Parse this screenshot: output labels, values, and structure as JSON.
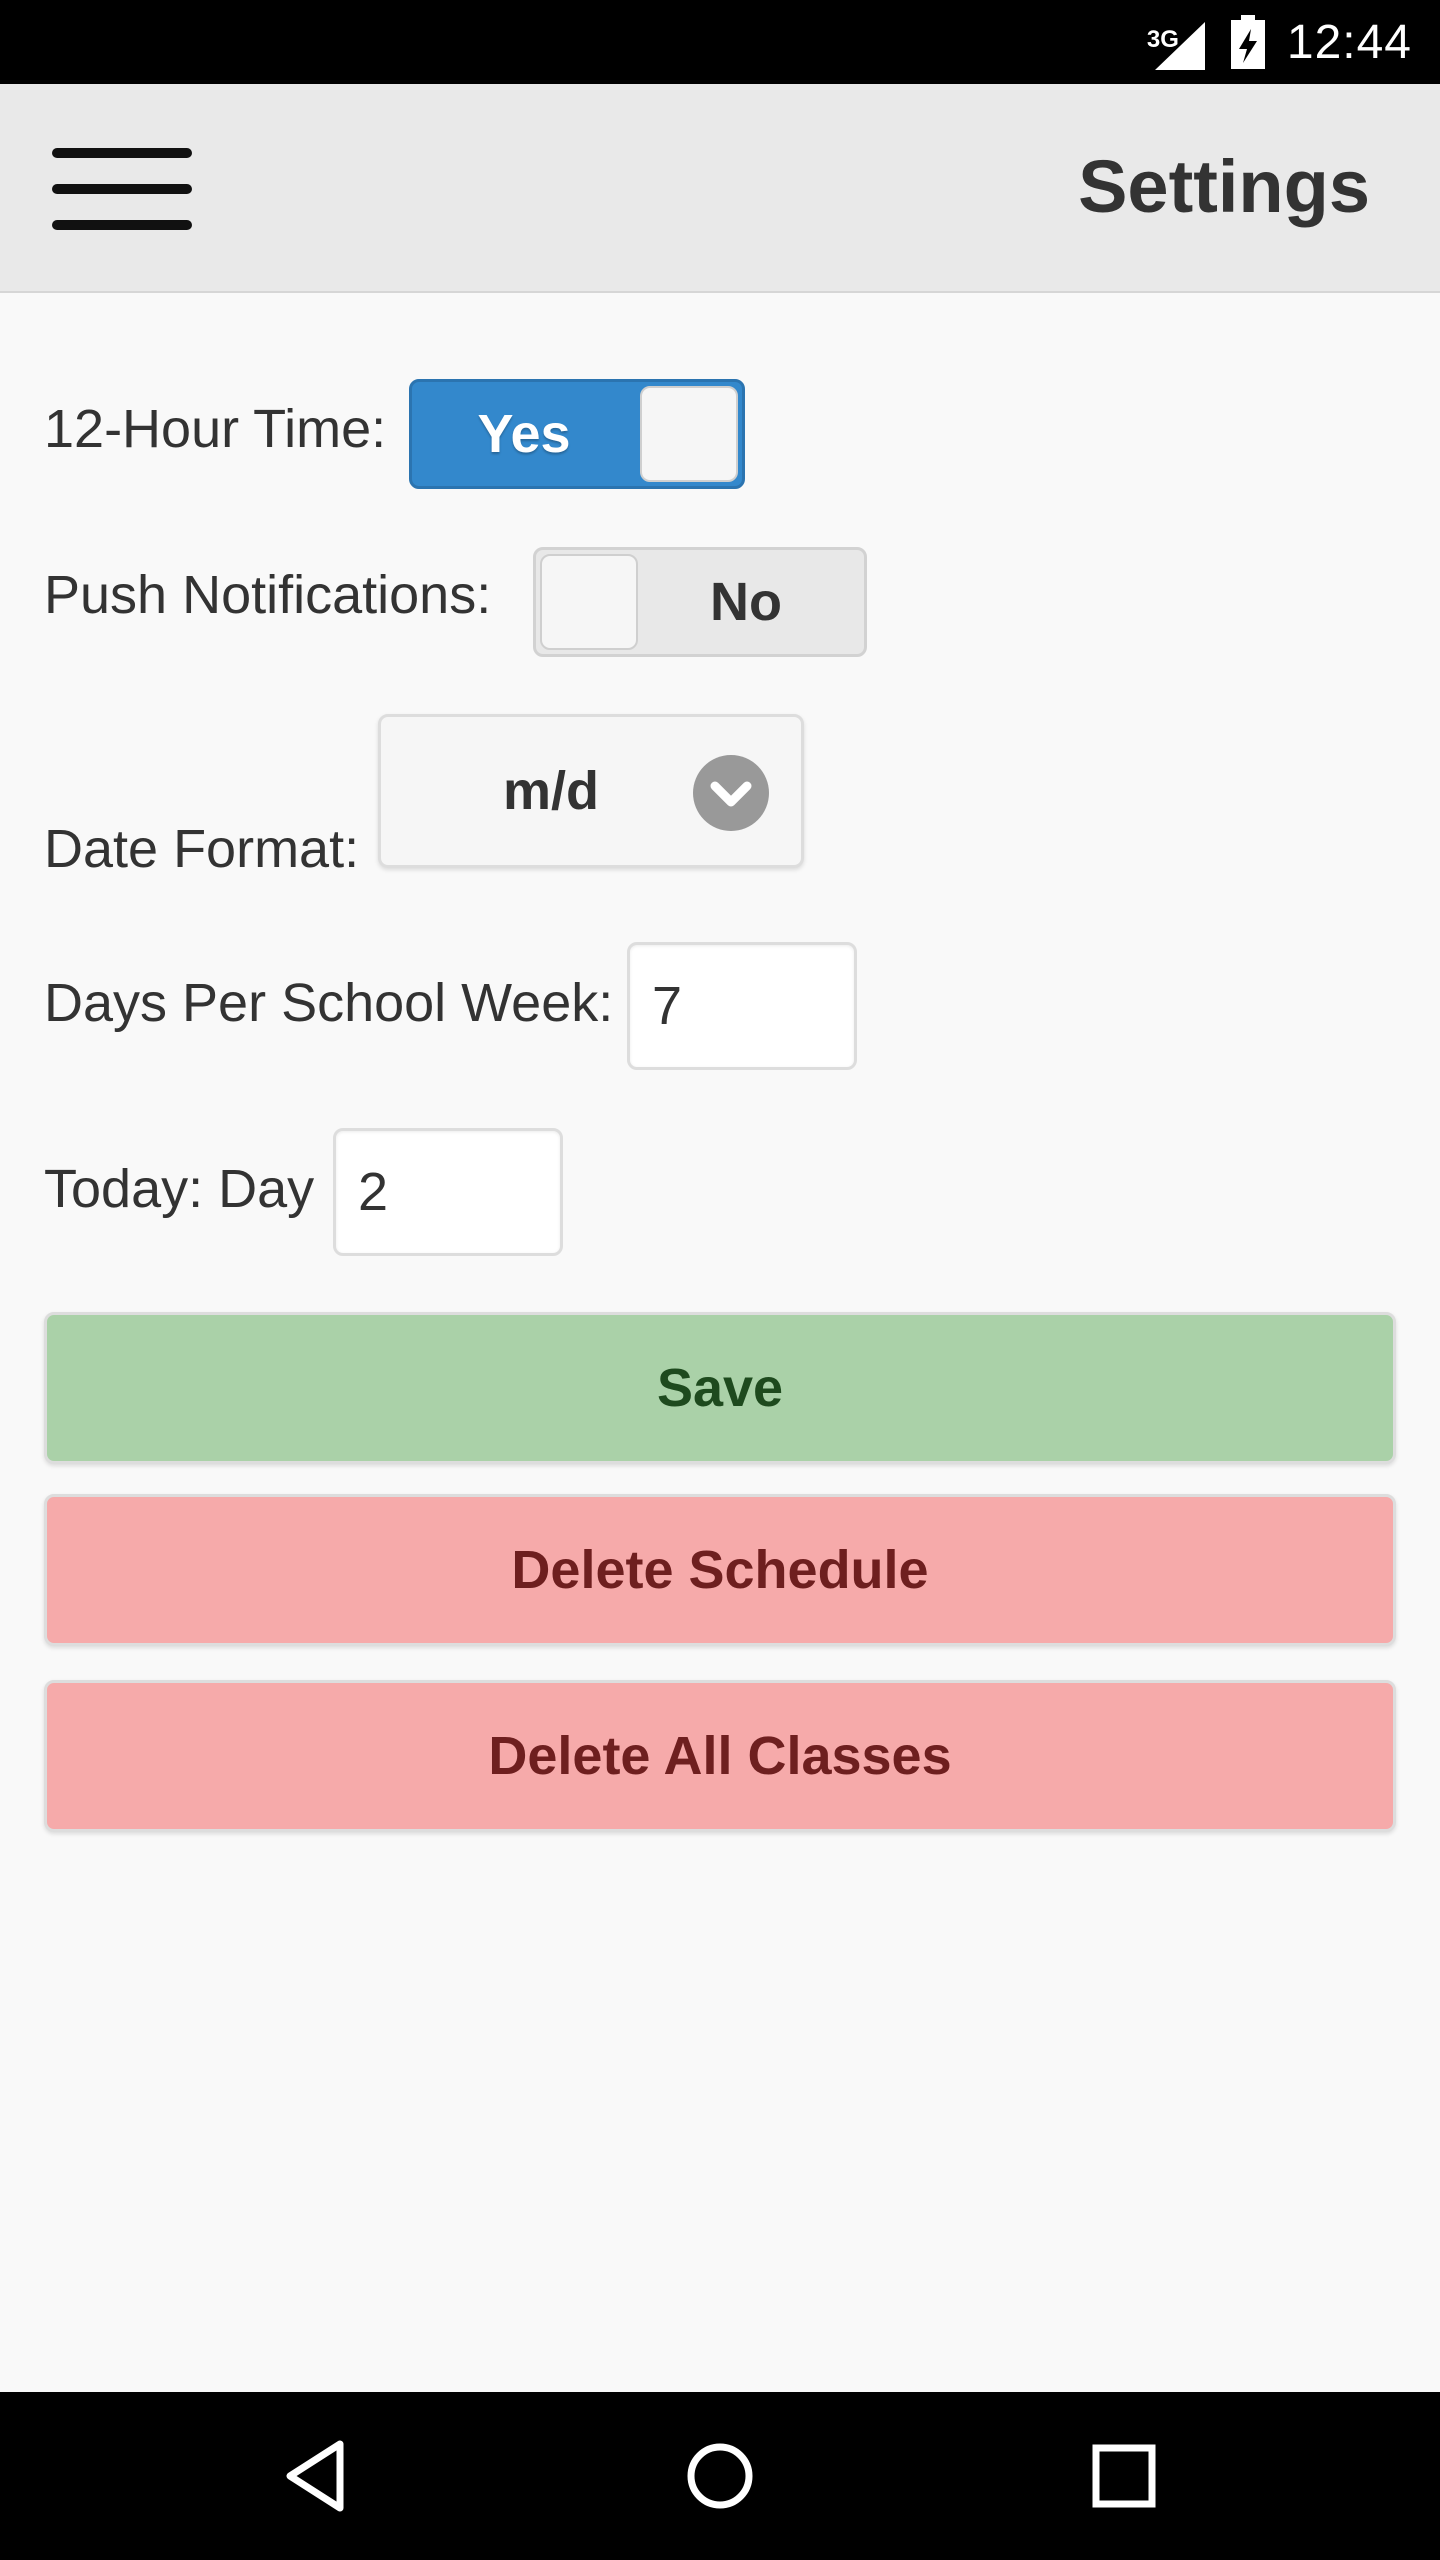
{
  "status_bar": {
    "network": "3G",
    "time": "12:44",
    "icons": [
      "signal-icon",
      "battery-icon"
    ]
  },
  "header": {
    "title": "Settings",
    "menu_icon": "hamburger-menu-icon"
  },
  "form": {
    "twelve_hour_time": {
      "label": "12-Hour Time:",
      "value": "Yes",
      "on": true
    },
    "push_notifications": {
      "label": "Push Notifications:",
      "value": "No",
      "on": false
    },
    "date_format": {
      "label": "Date Format:",
      "value": "m/d",
      "icon": "chevron-down-icon"
    },
    "days_per_week": {
      "label": "Days Per School Week:",
      "value": "7"
    },
    "today_day": {
      "label": "Today: Day",
      "value": "2"
    }
  },
  "buttons": {
    "save": "Save",
    "delete_schedule": "Delete Schedule",
    "delete_all_classes": "Delete All Classes"
  },
  "nav_bar": {
    "icons": [
      "back-icon",
      "home-icon",
      "recents-icon"
    ]
  },
  "colors": {
    "switch_on": "#3388cc",
    "save_button": "#aad1a8",
    "delete_button": "#f6aaaa",
    "header_bg": "#e9e9e9"
  }
}
